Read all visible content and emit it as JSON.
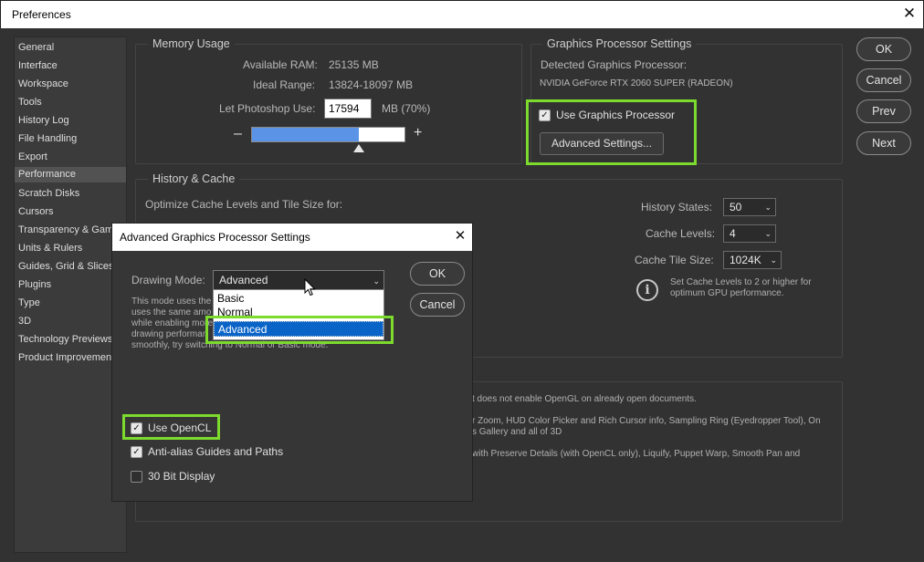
{
  "window": {
    "title": "Preferences",
    "close_glyph": "✕"
  },
  "sidebar": {
    "items": [
      {
        "label": "General"
      },
      {
        "label": "Interface"
      },
      {
        "label": "Workspace"
      },
      {
        "label": "Tools"
      },
      {
        "label": "History Log"
      },
      {
        "label": "File Handling"
      },
      {
        "label": "Export"
      },
      {
        "label": "Performance",
        "selected": true
      },
      {
        "label": "Scratch Disks"
      },
      {
        "label": "Cursors"
      },
      {
        "label": "Transparency & Gamut"
      },
      {
        "label": "Units & Rulers"
      },
      {
        "label": "Guides, Grid & Slices"
      },
      {
        "label": "Plugins"
      },
      {
        "label": "Type"
      },
      {
        "label": "3D"
      },
      {
        "label": "Technology Previews"
      },
      {
        "label": "Product Improvement"
      }
    ]
  },
  "buttons": {
    "ok": "OK",
    "cancel": "Cancel",
    "prev": "Prev",
    "next": "Next"
  },
  "memory": {
    "title": "Memory Usage",
    "available_label": "Available RAM:",
    "available_value": "25135 MB",
    "ideal_label": "Ideal Range:",
    "ideal_value": "13824-18097 MB",
    "let_label": "Let Photoshop Use:",
    "let_value": "17594",
    "let_unit": "MB (70%)",
    "minus": "–",
    "plus": "+",
    "slider_fraction": 0.7
  },
  "gpu": {
    "title": "Graphics Processor Settings",
    "detected_label": "Detected Graphics Processor:",
    "detected_value": "NVIDIA GeForce RTX 2060 SUPER (RADEON)",
    "use_label": "Use Graphics Processor",
    "use_checked": true,
    "advanced_button": "Advanced Settings..."
  },
  "history": {
    "title": "History & Cache",
    "optimize_label": "Optimize Cache Levels and Tile Size for:",
    "states_label": "History States:",
    "states_value": "50",
    "levels_label": "Cache Levels:",
    "levels_value": "4",
    "tile_label": "Cache Tile Size:",
    "tile_value": "1024K",
    "info_line1": "Set Cache Levels to 2 or higher for",
    "info_line2": "optimum GPU performance."
  },
  "background_text": {
    "line1": "t does not enable OpenGL on already open documents.",
    "line2": "r Zoom, HUD Color Picker and Rich Cursor info, Sampling Ring (Eyedropper Tool), On",
    "line3": "s Gallery and all of 3D",
    "line4": "with Preserve Details (with OpenCL only), Liquify, Puppet Warp, Smooth Pan and"
  },
  "advanced_dialog": {
    "title": "Advanced Graphics Processor Settings",
    "close_glyph": "✕",
    "drawing_mode_label": "Drawing Mode:",
    "drawing_mode_value": "Advanced",
    "ok": "OK",
    "cancel": "Cancel",
    "desc_line1": "This mode uses the",
    "desc_line2": "uses the same amo",
    "desc_line3": "while enabling more",
    "desc_line4": "drawing performan",
    "desc_line5": "smoothly, try switching to Normal or Basic mode.",
    "options": [
      {
        "label": "Basic"
      },
      {
        "label": "Normal"
      },
      {
        "label": "Advanced",
        "active": true
      }
    ],
    "use_opencl_label": "Use OpenCL",
    "use_opencl_checked": true,
    "antialias_label": "Anti-alias Guides and Paths",
    "antialias_checked": true,
    "bit30_label": "30 Bit Display",
    "bit30_checked": false,
    "check_glyph": "✓"
  },
  "colors": {
    "highlight": "#7ddb2e",
    "slider_fill": "#5b93e6",
    "selected_option": "#0a64c8"
  }
}
